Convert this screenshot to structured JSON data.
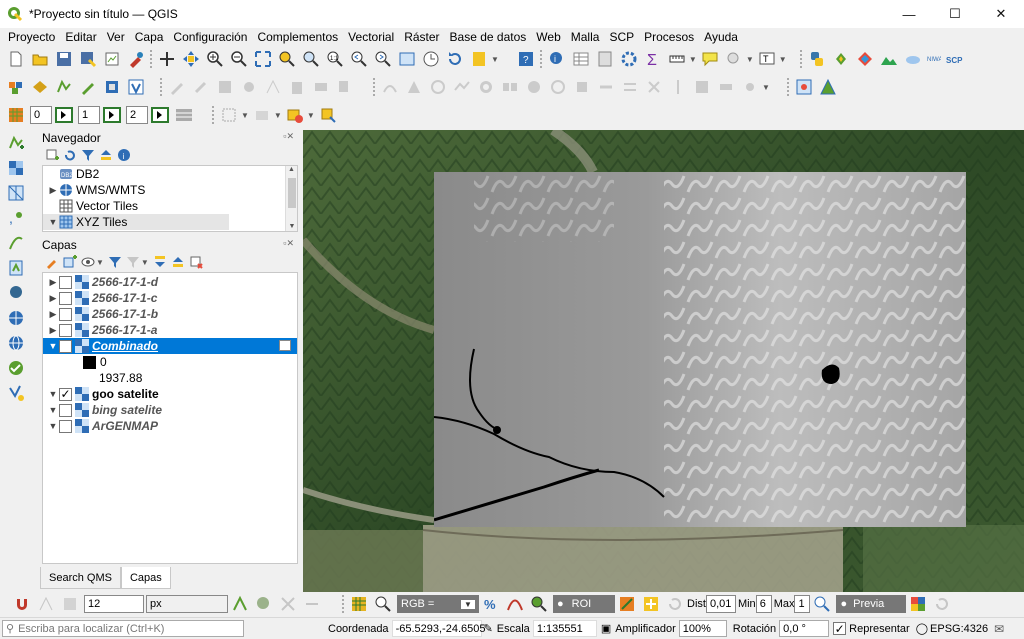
{
  "window": {
    "title": "*Proyecto sin título — QGIS"
  },
  "menu": [
    "Proyecto",
    "Editar",
    "Ver",
    "Capa",
    "Configuración",
    "Complementos",
    "Vectorial",
    "Ráster",
    "Base de datos",
    "Web",
    "Malla",
    "SCP",
    "Procesos",
    "Ayuda"
  ],
  "toolbar3": {
    "spin1": "0",
    "spin2": "1",
    "spin3": "2"
  },
  "navigator": {
    "title": "Navegador",
    "items": [
      {
        "label": "DB2",
        "icon": "db2-icon",
        "expandable": false
      },
      {
        "label": "WMS/WMTS",
        "icon": "globe-icon",
        "expandable": true,
        "expanded": false
      },
      {
        "label": "Vector Tiles",
        "icon": "vector-tiles-icon",
        "expandable": false
      },
      {
        "label": "XYZ Tiles",
        "icon": "xyz-tiles-icon",
        "expandable": true,
        "expanded": true
      }
    ]
  },
  "layers": {
    "title": "Capas",
    "items": [
      {
        "label": "2566-17-1-d",
        "checked": false,
        "style": "italic",
        "expanded": false
      },
      {
        "label": "2566-17-1-c",
        "checked": false,
        "style": "italic",
        "expanded": false
      },
      {
        "label": "2566-17-1-b",
        "checked": false,
        "style": "italic",
        "expanded": false
      },
      {
        "label": "2566-17-1-a",
        "checked": false,
        "style": "italic",
        "expanded": false
      },
      {
        "label": "Combinado",
        "checked": true,
        "style": "selected",
        "expanded": true
      },
      {
        "label": "goo satelite",
        "checked": true,
        "style": "bold",
        "expanded": true
      },
      {
        "label": "bing satelite",
        "checked": false,
        "style": "italic",
        "expanded": true
      },
      {
        "label": "ArGENMAP",
        "checked": false,
        "style": "italic",
        "expanded": true
      }
    ],
    "legend_min": "0",
    "legend_max": "1937.88"
  },
  "tabs": [
    "Search QMS",
    "Capas"
  ],
  "active_tab": "Capas",
  "bottom_toolbar": {
    "size_value": "12",
    "size_unit": "px",
    "rgb_label": "RGB =",
    "roi_label": "ROI",
    "dist_label": "Dist",
    "dist_value": "0,01",
    "min_label": "Min",
    "min_value": "6",
    "max_label": "Max",
    "max_value": "1",
    "preview_label": "Previa"
  },
  "status": {
    "locator_placeholder": "Escriba para localizar (Ctrl+K)",
    "coord_label": "Coordenada",
    "coord_value": "-65.5293,-24.6505",
    "scale_label": "Escala",
    "scale_value": "1:135551",
    "magnifier_label": "Amplificador",
    "magnifier_value": "100%",
    "rotation_label": "Rotación",
    "rotation_value": "0,0 °",
    "render_label": "Representar",
    "crs": "EPSG:4326"
  },
  "colors": {
    "selection": "#0078d7",
    "accent_green": "#5a9e2f",
    "qgis_yellow": "#f3c423"
  }
}
